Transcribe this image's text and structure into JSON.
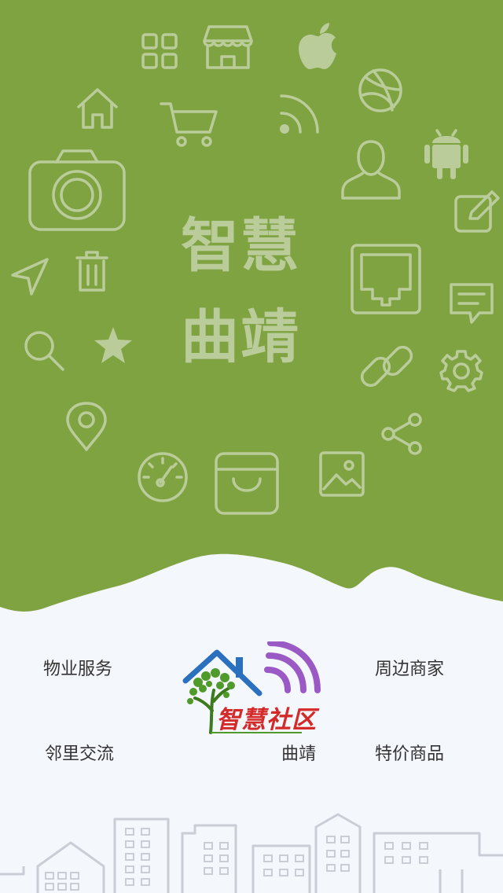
{
  "colors": {
    "hero_green": "#80a342",
    "icon_tint": "#b9cc9a",
    "background": "#f4f7fb",
    "logo_red": "#d42a2a",
    "logo_blue": "#2b6fbf",
    "logo_purple": "#9b59c6",
    "logo_tree_green": "#4f9a2a"
  },
  "hero": {
    "title_line1": "智慧",
    "title_line2": "曲靖",
    "icons": [
      "grid-icon",
      "store-icon",
      "apple-icon",
      "home-icon",
      "cart-icon",
      "rss-icon",
      "dribbble-icon",
      "camera-icon",
      "user-icon",
      "android-icon",
      "edit-icon",
      "send-icon",
      "trash-icon",
      "ethernet-icon",
      "message-icon",
      "search-icon",
      "star-icon",
      "link-icon",
      "gear-icon",
      "location-icon",
      "share-icon",
      "gauge-icon",
      "bag-icon",
      "image-icon"
    ]
  },
  "menu": {
    "property_service": "物业服务",
    "nearby_merchants": "周边商家",
    "neighbor_exchange": "邻里交流",
    "special_goods": "特价商品"
  },
  "logo": {
    "brand_text": "智慧社区",
    "city_label": "曲靖"
  }
}
